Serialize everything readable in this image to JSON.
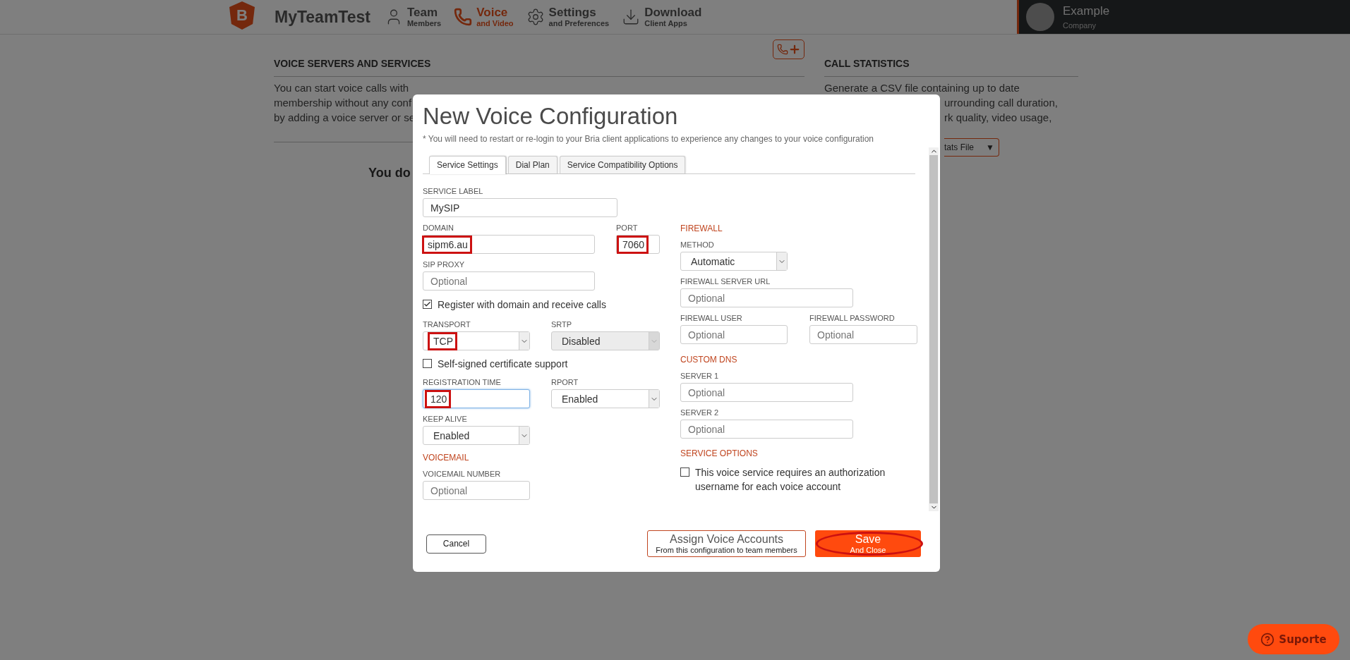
{
  "header": {
    "logo_letter": "B",
    "app_name": "MyTeamTest",
    "nav": [
      {
        "title": "Team",
        "subtitle": "Members",
        "selected": false
      },
      {
        "title": "Voice",
        "subtitle": "and Video",
        "selected": true
      },
      {
        "title": "Settings",
        "subtitle": "and Preferences",
        "selected": false
      },
      {
        "title": "Download",
        "subtitle": "Client Apps",
        "selected": false
      }
    ],
    "user": {
      "name": "Example",
      "company": "Company"
    }
  },
  "page": {
    "voice_section": {
      "heading": "VOICE SERVERS AND SERVICES",
      "text_lines": [
        "You can start voice calls with",
        "membership without any conf",
        "by adding a voice server or se"
      ],
      "notice": "You do"
    },
    "stats_section": {
      "heading": "CALL STATISTICS",
      "first_line": "Generate a CSV file containing up to date",
      "text_lines": [
        "urrounding call duration,",
        "rk quality, video usage,"
      ],
      "button": "tats File",
      "button_caret": "▼"
    }
  },
  "dialog": {
    "title": "New Voice Configuration",
    "note": "* You will need to restart or re-login to your Bria client applications to experience any changes to your voice configuration",
    "tabs": [
      {
        "label": "Service Settings",
        "selected": true
      },
      {
        "label": "Dial Plan",
        "selected": false
      },
      {
        "label": "Service Compatibility Options",
        "selected": false
      }
    ],
    "service_label": {
      "label": "SERVICE LABEL",
      "value": "MySIP",
      "highlighted": false,
      "focused": false
    },
    "domain": {
      "label": "DOMAIN",
      "value": "sipm6.au",
      "highlighted": true,
      "focused": false
    },
    "port": {
      "label": "PORT",
      "value": "7060",
      "highlighted": true,
      "focused": false
    },
    "sip_proxy": {
      "label": "SIP PROXY",
      "placeholder": "Optional",
      "focused": false
    },
    "register": {
      "label": "Register with domain and receive calls",
      "checked": true
    },
    "transport": {
      "label": "TRANSPORT",
      "value": "TCP",
      "highlighted": true,
      "disabled": false
    },
    "srtp": {
      "label": "SRTP",
      "value": "Disabled",
      "highlighted": false,
      "disabled": true
    },
    "self_signed": {
      "label": "Self-signed certificate support",
      "checked": false
    },
    "registration_time": {
      "label": "REGISTRATION TIME",
      "value": "120",
      "highlighted": true,
      "focused": true
    },
    "rport": {
      "label": "RPORT",
      "value": "Enabled",
      "highlighted": false,
      "disabled": false
    },
    "keep_alive": {
      "label": "KEEP ALIVE",
      "value": "Enabled",
      "highlighted": false,
      "disabled": false
    },
    "voicemail_heading": "VOICEMAIL",
    "voicemail_number": {
      "label": "VOICEMAIL NUMBER",
      "placeholder": "Optional",
      "focused": false
    },
    "firewall_heading": "FIREWALL",
    "method": {
      "label": "METHOD",
      "value": "Automatic",
      "highlighted": false,
      "disabled": false
    },
    "firewall_server_url": {
      "label": "FIREWALL SERVER URL",
      "placeholder": "Optional",
      "focused": false
    },
    "firewall_user": {
      "label": "FIREWALL USER",
      "placeholder": "Optional",
      "focused": false
    },
    "firewall_password": {
      "label": "FIREWALL PASSWORD",
      "placeholder": "Optional",
      "focused": false
    },
    "custom_dns_heading": "CUSTOM DNS",
    "server_1": {
      "label": "SERVER 1",
      "placeholder": "Optional",
      "focused": false
    },
    "server_2": {
      "label": "SERVER 2",
      "placeholder": "Optional",
      "focused": false
    },
    "service_options_heading": "SERVICE OPTIONS",
    "authorization": {
      "label": "This voice service requires an authorization username for each voice account",
      "checked": false
    },
    "cancel_button": "Cancel",
    "assign_button": {
      "title": "Assign Voice Accounts",
      "subtitle": "From this configuration to team members"
    },
    "save_button": {
      "title": "Save",
      "subtitle": "And Close",
      "circled": true
    }
  },
  "support_button": "Suporte"
}
